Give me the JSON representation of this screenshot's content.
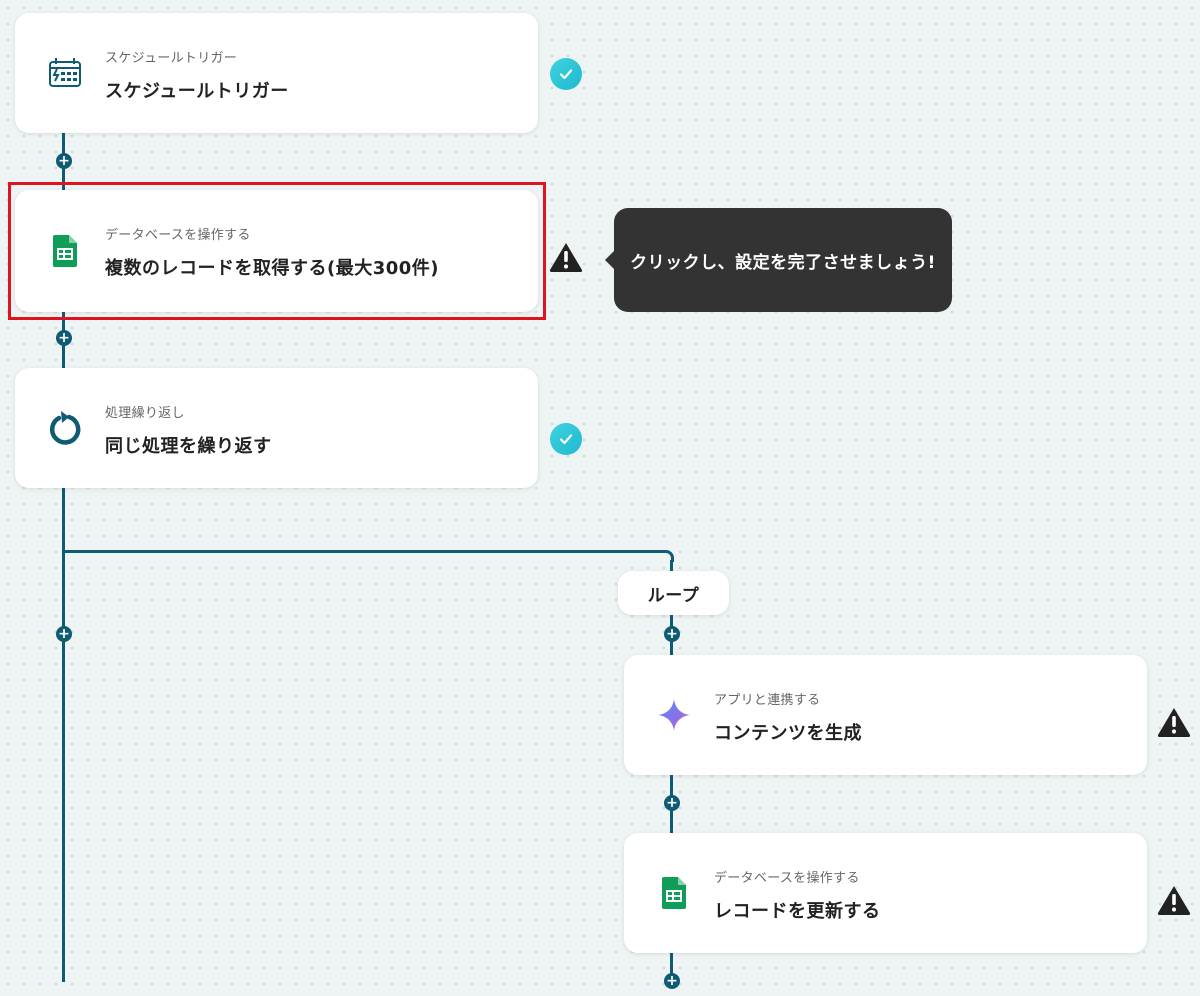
{
  "flow": {
    "steps": [
      {
        "category": "スケジュールトリガー",
        "title": "スケジュールトリガー",
        "icon": "calendar-schedule-icon",
        "status": "complete"
      },
      {
        "category": "データベースを操作する",
        "title": "複数のレコードを取得する(最大300件)",
        "icon": "google-sheets-icon",
        "status": "warning"
      },
      {
        "category": "処理繰り返し",
        "title": "同じ処理を繰り返す",
        "icon": "loop-arrow-icon",
        "status": "complete"
      }
    ],
    "tooltip": "クリックし、設定を完了させましょう!",
    "loop": {
      "label": "ループ",
      "steps": [
        {
          "category": "アプリと連携する",
          "title": "コンテンツを生成",
          "icon": "gemini-sparkle-icon",
          "status": "warning"
        },
        {
          "category": "データベースを操作する",
          "title": "レコードを更新する",
          "icon": "google-sheets-icon",
          "status": "warning"
        }
      ]
    }
  },
  "colors": {
    "connector": "#0f5b73",
    "highlight": "#e0141e",
    "check": "#1fb8cf",
    "sheets_green": "#0f9d58"
  }
}
